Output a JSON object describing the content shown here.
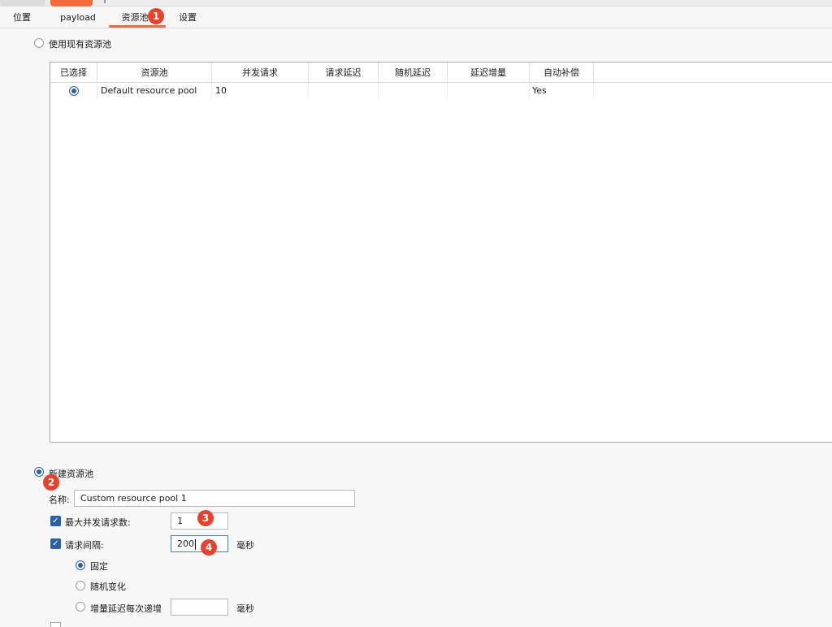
{
  "tabs": [
    {
      "label": "位置"
    },
    {
      "label": "payload"
    },
    {
      "label": "资源池"
    },
    {
      "label": "设置"
    }
  ],
  "existing_pool": {
    "radio_label": "使用现有资源池",
    "columns": [
      "已选择",
      "资源池",
      "并发请求",
      "请求延迟",
      "随机延迟",
      "延迟增量",
      "自动补偿"
    ],
    "rows": [
      {
        "selected": true,
        "name": "Default resource pool",
        "concurrent": "10",
        "request_delay": "",
        "random_delay": "",
        "delay_increment": "",
        "auto_backoff": "Yes"
      }
    ]
  },
  "new_pool": {
    "radio_label": "新建资源池",
    "name_label": "名称:",
    "name_value": "Custom resource pool 1",
    "max_concurrent_label": "最大并发请求数:",
    "max_concurrent_value": "1",
    "request_interval_label": "请求间隔:",
    "request_interval_value": "200",
    "ms_unit": "毫秒",
    "fixed_label": "固定",
    "random_label": "随机变化",
    "increment_label": "增量延迟每次递增",
    "increment_unit": "毫秒"
  },
  "annotations": [
    "1",
    "2",
    "3",
    "4"
  ],
  "colors": {
    "accent": "#f26b3a",
    "badge": "#e8412d",
    "selection": "#2b5fa8"
  }
}
